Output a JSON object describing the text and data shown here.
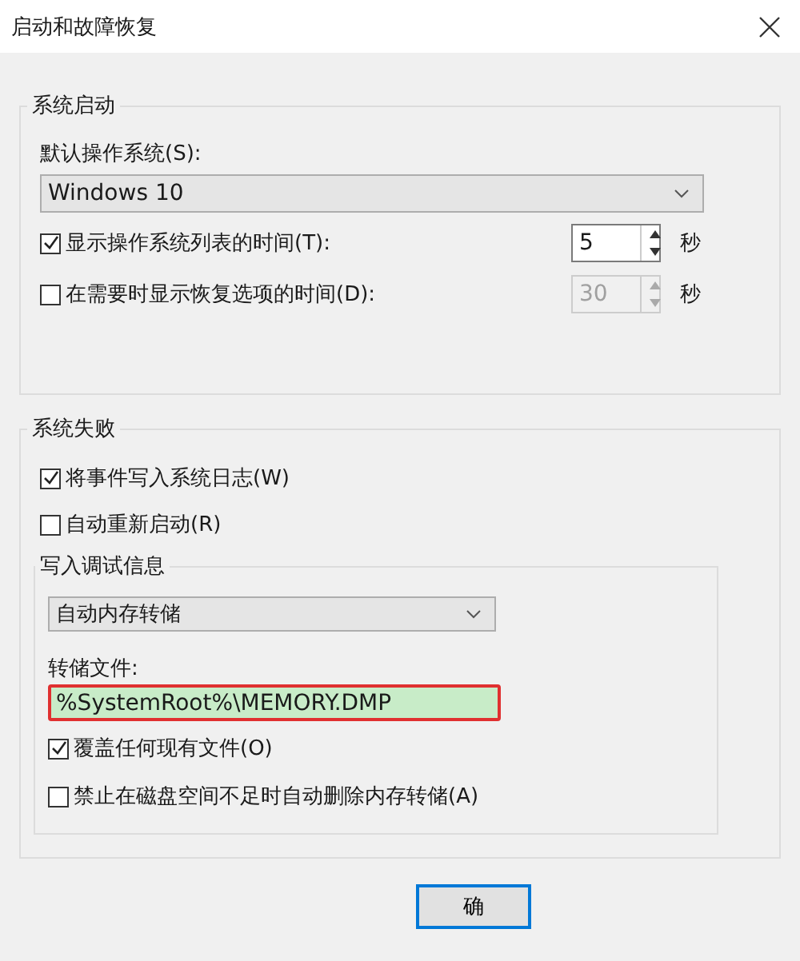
{
  "window": {
    "title": "启动和故障恢复"
  },
  "startup": {
    "title": "系统启动",
    "default_os_label": "默认操作系统(S):",
    "default_os": "Windows 10",
    "options": [
      {
        "label": "显示操作系统列表的时间(T):",
        "checked": true,
        "value": "5",
        "disabled": false,
        "unit": "秒"
      },
      {
        "label": "在需要时显示恢复选项的时间(D):",
        "checked": false,
        "value": "30",
        "disabled": true,
        "unit": "秒"
      }
    ]
  },
  "failure": {
    "title": "系统失败",
    "options": [
      {
        "label": "将事件写入系统日志(W)",
        "checked": true
      },
      {
        "label": "自动重新启动(R)",
        "checked": false
      }
    ],
    "debug": {
      "title": "写入调试信息",
      "type": "自动内存转储",
      "file_label": "转储文件:",
      "file": "%SystemRoot%\\MEMORY.DMP",
      "highlighted": true,
      "options": [
        {
          "label": "覆盖任何现有文件(O)",
          "checked": true
        },
        {
          "label": "禁止在磁盘空间不足时自动删除内存转储(A)",
          "checked": false
        }
      ]
    }
  },
  "buttons": [
    {
      "label": "确"
    }
  ]
}
